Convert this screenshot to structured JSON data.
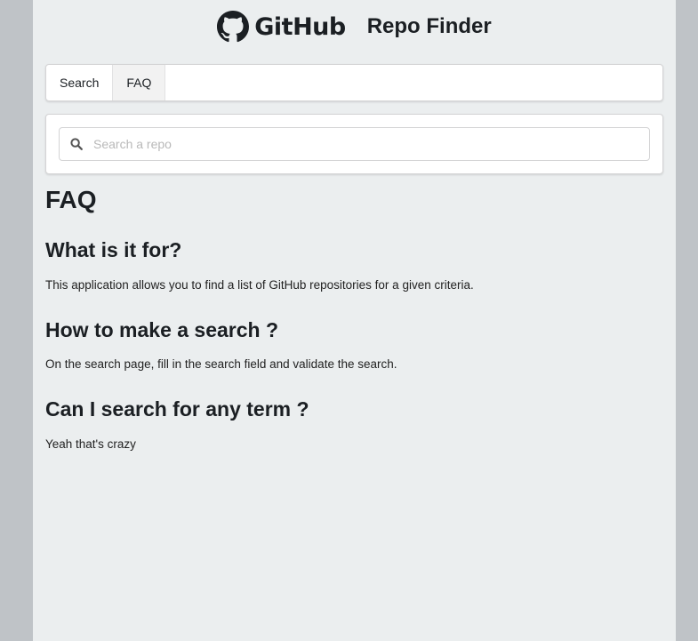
{
  "header": {
    "brand_wordmark": "GitHub",
    "app_title": "Repo Finder",
    "logo_icon": "octocat-icon"
  },
  "tabs": [
    {
      "label": "Search",
      "active": false
    },
    {
      "label": "FAQ",
      "active": true
    }
  ],
  "search": {
    "placeholder": "Search a repo",
    "value": "",
    "icon": "search-icon"
  },
  "faq": {
    "title": "FAQ",
    "items": [
      {
        "question": "What is it for?",
        "answer": "This application allows you to find a list of GitHub repositories for a given criteria."
      },
      {
        "question": "How to make a search ?",
        "answer": "On the search page, fill in the search field and validate the search."
      },
      {
        "question": "Can I search for any term ?",
        "answer": "Yeah that's crazy"
      }
    ]
  },
  "colors": {
    "outer_background": "#bfc3c7",
    "page_background": "#ebeeef",
    "active_tab": "#f2f2f2"
  }
}
